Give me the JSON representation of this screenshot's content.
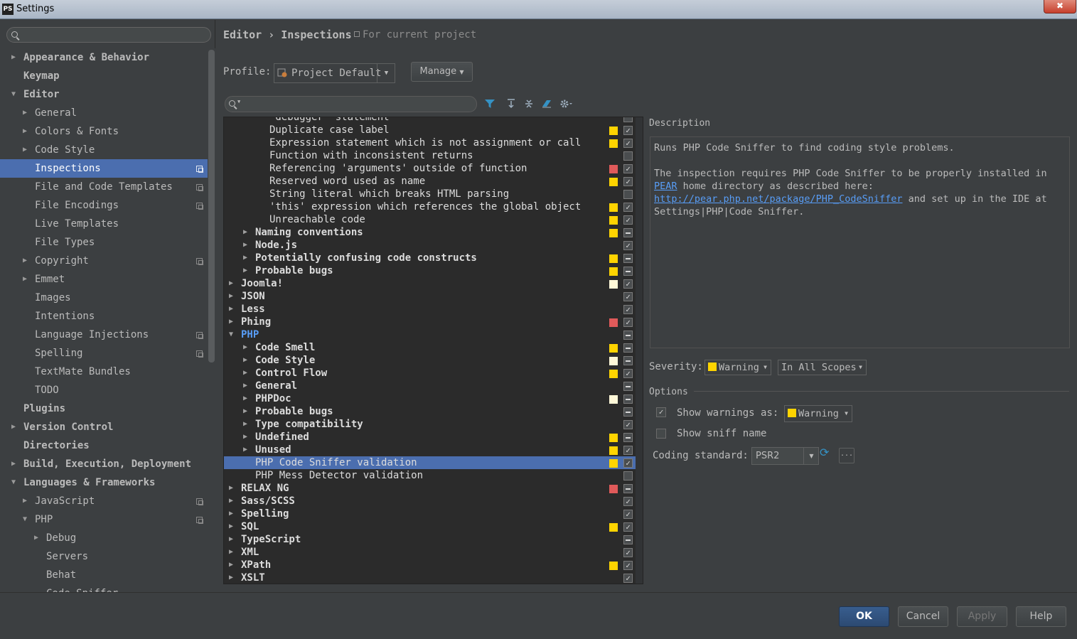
{
  "window": {
    "title": "Settings",
    "app_icon": "PS",
    "close": "✖"
  },
  "sidebar": {
    "items": [
      {
        "label": "Appearance & Behavior",
        "expanded": false
      },
      {
        "label": "Keymap"
      },
      {
        "label": "Editor",
        "expanded": true
      },
      {
        "label": "General"
      },
      {
        "label": "Colors & Fonts"
      },
      {
        "label": "Code Style"
      },
      {
        "label": "Inspections",
        "selected": true
      },
      {
        "label": "File and Code Templates"
      },
      {
        "label": "File Encodings"
      },
      {
        "label": "Live Templates"
      },
      {
        "label": "File Types"
      },
      {
        "label": "Copyright"
      },
      {
        "label": "Emmet"
      },
      {
        "label": "Images"
      },
      {
        "label": "Intentions"
      },
      {
        "label": "Language Injections"
      },
      {
        "label": "Spelling"
      },
      {
        "label": "TextMate Bundles"
      },
      {
        "label": "TODO"
      },
      {
        "label": "Plugins"
      },
      {
        "label": "Version Control"
      },
      {
        "label": "Directories"
      },
      {
        "label": "Build, Execution, Deployment"
      },
      {
        "label": "Languages & Frameworks",
        "expanded": true
      },
      {
        "label": "JavaScript"
      },
      {
        "label": "PHP",
        "expanded": true
      },
      {
        "label": "Debug"
      },
      {
        "label": "Servers"
      },
      {
        "label": "Behat"
      },
      {
        "label": "Code Sniffer"
      }
    ]
  },
  "header": {
    "crumb1": "Editor",
    "crumb2": "Inspections",
    "sep": "›",
    "note": "For current project"
  },
  "profile": {
    "label": "Profile:",
    "value": "Project Default",
    "manage": "Manage"
  },
  "inspections": [
    {
      "label": "'debugger' statement",
      "level": 2
    },
    {
      "label": "Duplicate case label",
      "level": 2,
      "color": "#ffd400",
      "check": "on"
    },
    {
      "label": "Expression statement which is not assignment or call",
      "level": 2,
      "color": "#ffd400",
      "check": "on"
    },
    {
      "label": "Function with inconsistent returns",
      "level": 2,
      "check": "off"
    },
    {
      "label": "Referencing 'arguments' outside of function",
      "level": 2,
      "color": "#e05a5a",
      "check": "on"
    },
    {
      "label": "Reserved word used as name",
      "level": 2,
      "color": "#ffd400",
      "check": "on"
    },
    {
      "label": "String literal which breaks HTML parsing",
      "level": 2,
      "check": "off"
    },
    {
      "label": "'this' expression which references the global object",
      "level": 2,
      "color": "#ffd400",
      "check": "on"
    },
    {
      "label": "Unreachable code",
      "level": 2,
      "color": "#ffd400",
      "check": "on"
    },
    {
      "label": "Naming conventions",
      "level": 1,
      "group": true,
      "color": "#ffd400",
      "check": "part"
    },
    {
      "label": "Node.js",
      "level": 1,
      "group": true,
      "check": "on"
    },
    {
      "label": "Potentially confusing code constructs",
      "level": 1,
      "group": true,
      "color": "#ffd400",
      "check": "part"
    },
    {
      "label": "Probable bugs",
      "level": 1,
      "group": true,
      "color": "#ffd400",
      "check": "part"
    },
    {
      "label": "Joomla!",
      "level": 0,
      "group": true,
      "color": "#fff8d8",
      "check": "on"
    },
    {
      "label": "JSON",
      "level": 0,
      "group": true,
      "check": "on"
    },
    {
      "label": "Less",
      "level": 0,
      "group": true,
      "check": "on"
    },
    {
      "label": "Phing",
      "level": 0,
      "group": true,
      "color": "#e05a5a",
      "check": "on"
    },
    {
      "label": "PHP",
      "level": 0,
      "group": true,
      "expanded": true,
      "blue": true,
      "check": "part"
    },
    {
      "label": "Code Smell",
      "level": 1,
      "group": true,
      "color": "#ffd400",
      "check": "part"
    },
    {
      "label": "Code Style",
      "level": 1,
      "group": true,
      "color": "#fff8d8",
      "check": "part"
    },
    {
      "label": "Control Flow",
      "level": 1,
      "group": true,
      "color": "#ffd400",
      "check": "on"
    },
    {
      "label": "General",
      "level": 1,
      "group": true,
      "check": "part"
    },
    {
      "label": "PHPDoc",
      "level": 1,
      "group": true,
      "color": "#fff8d8",
      "check": "part"
    },
    {
      "label": "Probable bugs",
      "level": 1,
      "group": true,
      "check": "part"
    },
    {
      "label": "Type compatibility",
      "level": 1,
      "group": true,
      "check": "on"
    },
    {
      "label": "Undefined",
      "level": 1,
      "group": true,
      "color": "#ffd400",
      "check": "part"
    },
    {
      "label": "Unused",
      "level": 1,
      "group": true,
      "color": "#ffd400",
      "check": "on"
    },
    {
      "label": "PHP Code Sniffer validation",
      "level": 1,
      "selected": true,
      "color": "#ffd400",
      "check": "on"
    },
    {
      "label": "PHP Mess Detector validation",
      "level": 1,
      "check": "off"
    },
    {
      "label": "RELAX NG",
      "level": 0,
      "group": true,
      "color": "#e05a5a",
      "check": "part"
    },
    {
      "label": "Sass/SCSS",
      "level": 0,
      "group": true,
      "check": "on"
    },
    {
      "label": "Spelling",
      "level": 0,
      "group": true,
      "check": "on"
    },
    {
      "label": "SQL",
      "level": 0,
      "group": true,
      "color": "#ffd400",
      "check": "on"
    },
    {
      "label": "TypeScript",
      "level": 0,
      "group": true,
      "check": "part"
    },
    {
      "label": "XML",
      "level": 0,
      "group": true,
      "check": "on"
    },
    {
      "label": "XPath",
      "level": 0,
      "group": true,
      "color": "#ffd400",
      "check": "on"
    },
    {
      "label": "XSLT",
      "level": 0,
      "group": true,
      "check": "on"
    }
  ],
  "description": {
    "label": "Description",
    "line1": "Runs PHP Code Sniffer to find coding style problems.",
    "line2a": "The inspection requires PHP Code Sniffer to be properly installed in",
    "pear": "PEAR",
    "line2b": " home directory as described here:",
    "url": "http://pear.php.net/package/PHP_CodeSniffer",
    "line3b": " and set up in the IDE at",
    "line4": "Settings|PHP|Code Sniffer."
  },
  "severity": {
    "label": "Severity:",
    "value": "Warning",
    "scope": "In All Scopes"
  },
  "options": {
    "label": "Options",
    "show_warnings": "Show warnings as:",
    "warnings_value": "Warning",
    "show_sniff": "Show sniff name",
    "coding_label": "Coding standard:",
    "coding_value": "PSR2",
    "dots": "..."
  },
  "buttons": {
    "ok": "OK",
    "cancel": "Cancel",
    "apply": "Apply",
    "help": "Help"
  }
}
